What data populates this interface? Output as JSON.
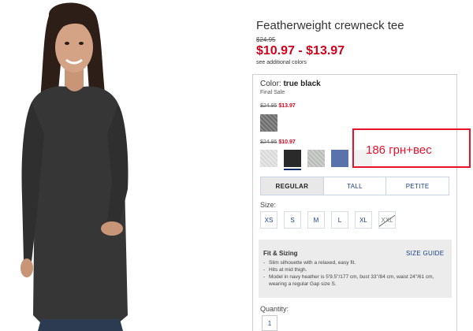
{
  "product": {
    "title": "Featherweight crewneck tee",
    "original_price": "$24.95",
    "price_range": "$10.97 - $13.97",
    "see_additional_colors": "see additional colors"
  },
  "color": {
    "label": "Color:",
    "selected": "true black",
    "sale_note": "Final Sale"
  },
  "price_tiers": [
    {
      "was": "$24.95",
      "now": "$13.97"
    },
    {
      "was": "$24.95",
      "now": "$10.97"
    }
  ],
  "swatches": [
    {
      "name": "heather dark grey",
      "color": "#7a7a7a"
    },
    {
      "name": "light grey",
      "color": "#dedede"
    },
    {
      "name": "true black",
      "color": "#2a2a2a",
      "selected": true
    },
    {
      "name": "silver heather",
      "color": "#c4c6c3"
    },
    {
      "name": "blue heather",
      "color": "#5a72ac"
    },
    {
      "name": "white",
      "color": "#f2f2f2"
    }
  ],
  "fit_tabs": [
    {
      "label": "REGULAR",
      "active": true
    },
    {
      "label": "TALL",
      "active": false
    },
    {
      "label": "PETITE",
      "active": false
    }
  ],
  "sizes": {
    "label": "Size:",
    "options": [
      {
        "label": "XS",
        "available": true
      },
      {
        "label": "S",
        "available": true
      },
      {
        "label": "M",
        "available": true
      },
      {
        "label": "L",
        "available": true
      },
      {
        "label": "XL",
        "available": true
      },
      {
        "label": "XXL",
        "available": false
      }
    ]
  },
  "fit_sizing": {
    "heading": "Fit & Sizing",
    "size_guide": "SIZE GUIDE",
    "bullets": [
      "Slim silhouette with a relaxed, easy fit.",
      "Hits at mid thigh.",
      "Model in navy heather is 5'9.5\"/177 cm, bust 33\"/84 cm, waist 24\"/61 cm, wearing a regular Gap size S."
    ]
  },
  "quantity": {
    "label": "Quantity:",
    "value": "1"
  },
  "annotation": {
    "text": "186 грн+вес",
    "color": "#e8122c"
  },
  "colors": {
    "sale_red": "#d0021b",
    "link_blue": "#1a3f8a"
  }
}
